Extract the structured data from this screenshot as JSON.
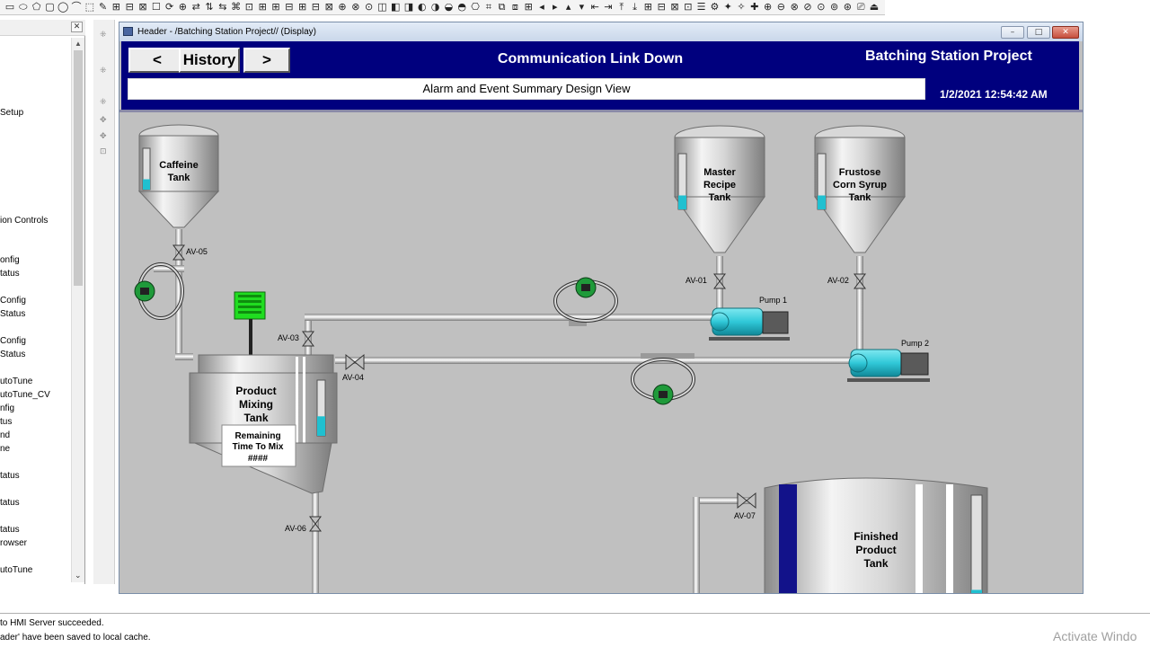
{
  "tree": {
    "items": [
      "Setup",
      "ion Controls",
      "onfig",
      "tatus",
      "Config",
      "Status",
      "Config",
      "Status",
      "utoTune",
      "utoTune_CV",
      "nfig",
      "tus",
      "nd",
      "ne",
      "tatus",
      "tatus",
      "tatus",
      "rowser",
      "utoTune"
    ]
  },
  "window": {
    "title": "Header - /Batching Station Project// (Display)",
    "minimize_label": "–",
    "maximize_label": "□",
    "close_label": "✕"
  },
  "header": {
    "back_label": "<",
    "history_label": "History",
    "forward_label": ">",
    "title": "Communication Link Down",
    "project_title": "Batching Station Project",
    "alarm_banner": "Alarm and Event Summary Design View",
    "datetime": "1/2/2021 12:54:42 AM"
  },
  "process": {
    "tanks": {
      "caffeine": [
        "Caffeine",
        "Tank"
      ],
      "master_recipe": [
        "Master",
        "Recipe",
        "Tank"
      ],
      "frustose": [
        "Frustose",
        "Corn Syrup",
        "Tank"
      ],
      "mixing": [
        "Product",
        "Mixing",
        "Tank"
      ],
      "finished": [
        "Finished",
        "Product",
        "Tank"
      ]
    },
    "timer": {
      "label": [
        "Remaining",
        "Time To Mix"
      ],
      "value": "####"
    },
    "valves": {
      "av01": "AV-01",
      "av02": "AV-02",
      "av03": "AV-03",
      "av04": "AV-04",
      "av05": "AV-05",
      "av06": "AV-06",
      "av07": "AV-07"
    },
    "pumps": {
      "pump1": "Pump 1",
      "pump2": "Pump 2"
    },
    "levels": {
      "caffeine": 0.25,
      "master_recipe": 0.25,
      "frustose": 0.25,
      "mixing": 0.35,
      "finished": 0.05
    }
  },
  "status": {
    "line1": "to HMI Server succeeded.",
    "line2": "ader' have been saved to local cache."
  },
  "watermark": "Activate Windo",
  "colors": {
    "header_bg": "#00007e",
    "level_fill": "#20c0d0",
    "pump_color": "#30c8d8",
    "agitator": "#22dd22",
    "canvas_bg": "#c0c0c0"
  }
}
